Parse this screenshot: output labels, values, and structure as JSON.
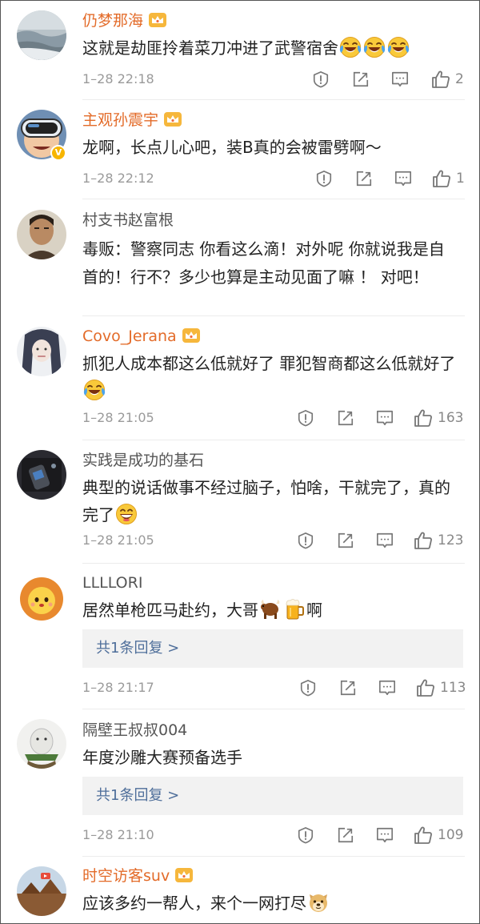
{
  "comments": [
    {
      "username": "仍梦那海",
      "vip": true,
      "text": "这就是劫匪拎着菜刀冲进了武警宿舍",
      "emojis": [
        "laugh-cry",
        "laugh-cry",
        "laugh-cry"
      ],
      "time": "1–28 22:18",
      "likes": "2"
    },
    {
      "username": "主观孙震宇",
      "vip": true,
      "verified": "V",
      "text": "龙啊，长点儿心吧，装B真的会被雷劈啊～",
      "time": "1–28 22:12",
      "likes": "1"
    },
    {
      "username": "村支书赵富根",
      "vip": false,
      "text": "毒贩：警察同志 你看这么滴！对外呢 你就说我是自首的！行不？多少也算是主动见面了嘛 ！ 对吧！"
    },
    {
      "username": "Covo_Jerana",
      "vip": true,
      "text": "抓犯人成本都这么低就好了 罪犯智商都这么低就好了",
      "emojis": [
        "laugh-cry"
      ],
      "time": "1–28 21:05",
      "likes": "163"
    },
    {
      "username": "实践是成功的基石",
      "vip": false,
      "text": "典型的说话做事不经过脑子，怕啥，干就完了，真的完了",
      "emojis": [
        "grin"
      ],
      "time": "1–28 21:05",
      "likes": "123"
    },
    {
      "username": "LLLLORI",
      "vip": false,
      "text_before": "居然单枪匹马赴约，大哥",
      "emojis": [
        "bull",
        "beer"
      ],
      "text_after": "啊",
      "reply_label": "共1条回复 >",
      "time": "1–28 21:17",
      "likes": "113"
    },
    {
      "username": "隔壁王叔叔004",
      "vip": false,
      "text": "年度沙雕大赛预备选手",
      "reply_label": "共1条回复 >",
      "time": "1–28 21:10",
      "likes": "109"
    },
    {
      "username": "时空访客suv",
      "vip": true,
      "text": "应该多约一帮人，来个一网打尽",
      "emojis": [
        "doge"
      ]
    }
  ],
  "colors": {
    "vip_name": "#e36b29",
    "plain_name": "#555555",
    "reply_link": "#4e6e9a",
    "meta": "#9a9a9a"
  }
}
